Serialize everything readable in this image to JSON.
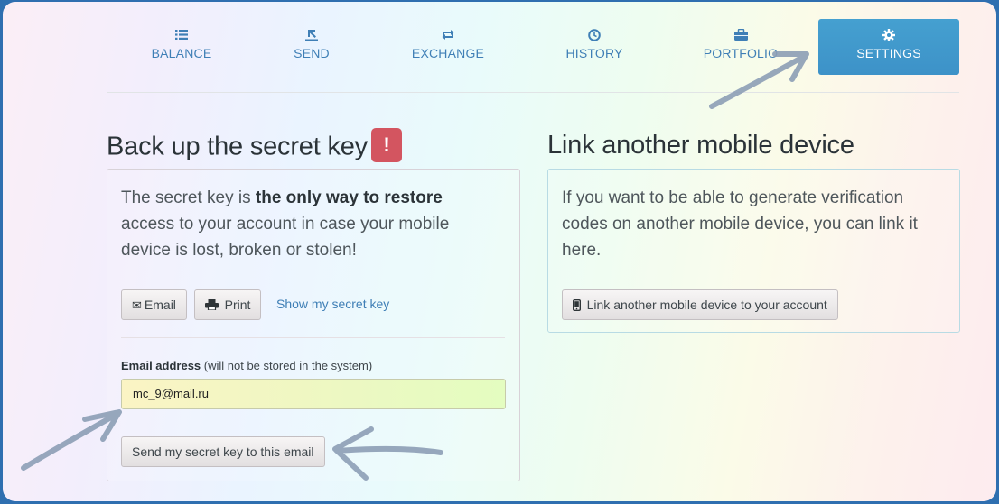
{
  "nav": {
    "items": [
      {
        "label": "BALANCE",
        "icon": "list-icon"
      },
      {
        "label": "SEND",
        "icon": "send-icon"
      },
      {
        "label": "EXCHANGE",
        "icon": "exchange-icon"
      },
      {
        "label": "HISTORY",
        "icon": "clock-icon"
      },
      {
        "label": "PORTFOLIO",
        "icon": "briefcase-icon"
      },
      {
        "label": "SETTINGS",
        "icon": "gear-icon",
        "active": true
      }
    ]
  },
  "backup": {
    "title": "Back up the secret key",
    "warning_badge": "!",
    "lead_pre": "The secret key is ",
    "lead_bold": "the only way to restore",
    "lead_post": " access to your account in case your mobile device is lost, broken or stolen!",
    "email_button": "Email",
    "print_button": "Print",
    "show_key_link": "Show my secret key",
    "email_label_bold": "Email address",
    "email_label_note": " (will not be stored in the system)",
    "email_value": "mc_9@mail.ru",
    "send_button": "Send my secret key to this email"
  },
  "link_device": {
    "title": "Link another mobile device",
    "lead": "If you want to be able to generate verification codes on another mobile device, you can link it here.",
    "button": "Link another mobile device to your account"
  },
  "colors": {
    "accent": "#3f7fb6",
    "active_tab": "#3d92c8",
    "warning": "#d35560",
    "annotation_arrow": "#8d9fb6"
  }
}
